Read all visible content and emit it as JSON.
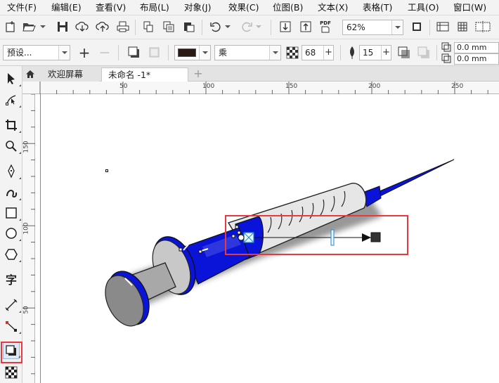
{
  "menu": [
    "文件(F)",
    "编辑(E)",
    "查看(V)",
    "布局(L)",
    "对象(J)",
    "效果(C)",
    "位图(B)",
    "文本(X)",
    "表格(T)",
    "工具(O)",
    "窗口(W)"
  ],
  "toolbar": {
    "pdf_label": "PDF",
    "zoom_value": "62%"
  },
  "propertybar": {
    "preset_value": "预设...",
    "plus_sign": "+",
    "minus_sign": "—",
    "merge_mode": "乘",
    "transparency_value": "68",
    "feather_value": "15",
    "offset_x": "0.0 mm",
    "offset_y": "0.0 mm",
    "shadow_color": "#2b1a14"
  },
  "toolbox": {
    "text_tool_label": "字"
  },
  "tabs": {
    "welcome": "欢迎屏幕",
    "document": "未命名 -1*",
    "add": "+"
  },
  "ruler": {
    "h_labels": [
      "50",
      "100",
      "150",
      "200",
      "250"
    ],
    "v_labels": [
      "150",
      "100",
      "50"
    ]
  },
  "colors": {
    "accent_highlight": "#e8393f",
    "syringe_blue": "#0a14d8",
    "plunger_gray": "#a8a8a8",
    "barrel_fill": "#e6e6e6"
  }
}
